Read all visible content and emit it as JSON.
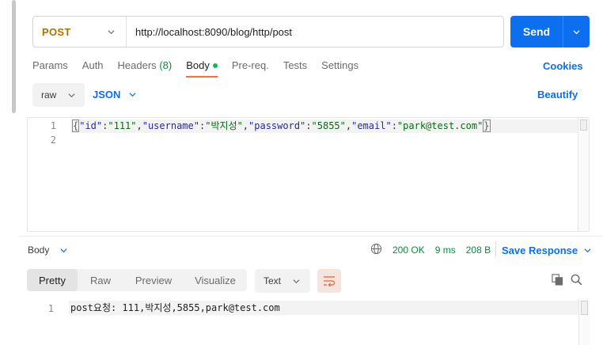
{
  "request": {
    "method": "POST",
    "url": "http://localhost:8090/blog/http/post",
    "send_label": "Send"
  },
  "tabs": {
    "params": "Params",
    "auth": "Auth",
    "headers": "Headers",
    "headers_count": "(8)",
    "body": "Body",
    "prereq": "Pre-req.",
    "tests": "Tests",
    "settings": "Settings",
    "cookies": "Cookies"
  },
  "body_options": {
    "mode": "raw",
    "language": "JSON",
    "beautify": "Beautify"
  },
  "request_body": {
    "line_numbers": [
      "1",
      "2"
    ],
    "tokens": [
      {
        "t": "{",
        "c": "cbrace"
      },
      {
        "t": "\"id\"",
        "c": "tok-k"
      },
      {
        "t": ":",
        "c": "tok-p"
      },
      {
        "t": "\"111\"",
        "c": "tok-s"
      },
      {
        "t": ",",
        "c": "tok-p"
      },
      {
        "t": "\"username\"",
        "c": "tok-k"
      },
      {
        "t": ":",
        "c": "tok-p"
      },
      {
        "t": "\"박지성\"",
        "c": "tok-s"
      },
      {
        "t": ",",
        "c": "tok-p"
      },
      {
        "t": "\"password\"",
        "c": "tok-k"
      },
      {
        "t": ":",
        "c": "tok-p"
      },
      {
        "t": "\"5855\"",
        "c": "tok-s"
      },
      {
        "t": ",",
        "c": "tok-p"
      },
      {
        "t": "\"email\"",
        "c": "tok-k"
      },
      {
        "t": ":",
        "c": "tok-p"
      },
      {
        "t": "\"park@test.com\"",
        "c": "tok-s"
      },
      {
        "t": "}",
        "c": "cbrace"
      }
    ]
  },
  "response": {
    "section_label": "Body",
    "status": "200 OK",
    "time": "9 ms",
    "size": "208 B",
    "save_label": "Save Response",
    "views": [
      "Pretty",
      "Raw",
      "Preview",
      "Visualize"
    ],
    "format": "Text",
    "line_number": "1",
    "content": "post요청: 111,박지성,5855,park@test.com"
  },
  "colors": {
    "accent": "#0c6ff0",
    "method": "#a87500",
    "status_ok": "#0b8a3e",
    "active_tab": "#ff6c37"
  }
}
